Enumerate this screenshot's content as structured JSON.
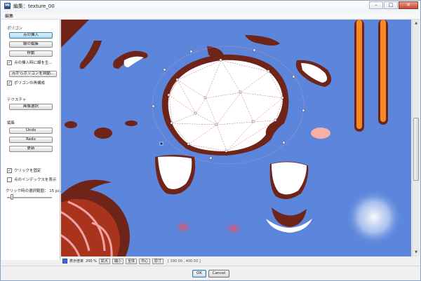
{
  "window": {
    "title": "編集：texture_00"
  },
  "menu": {
    "items": [
      "編集"
    ]
  },
  "panel": {
    "polygon_label": "ポリゴン",
    "insert_point": "点の挿入",
    "edit_line": "線の編集",
    "move": "移動",
    "insert_connect": "点の挿入時に線を生...",
    "auto_polygon": "点からポリゴンを自動...",
    "rebuild_polygon": "ポリゴンの再構成",
    "texture_label": "テクスチャ",
    "select_image": "画像選択",
    "edit_label": "編集",
    "undo": "Undo",
    "redo": "Redo",
    "refresh": "更新",
    "fix_click": "クリックを固定",
    "show_index": "点のインデックスを表示",
    "range_label": "クリック時の選択範囲：",
    "range_value": "15 pi..."
  },
  "status": {
    "zoom_label": "表示倍率",
    "zoom_value": "200 %",
    "zoom_in": "拡大",
    "zoom_out": "縮小",
    "fit_all": "全体",
    "center": "中心",
    "actual": "原寸",
    "coords": "[ 390.00 , 400.50 ]"
  },
  "dialog": {
    "ok": "OK",
    "cancel": "Cancel"
  },
  "colors": {
    "canvas_bg": "#5b86db",
    "brown": "#6e2418",
    "mesh_line": "#c0504d",
    "accent": "#3c7fb1"
  },
  "icons": {
    "app": "app-icon",
    "minimize": "minimize-icon",
    "maximize": "maximize-icon",
    "close": "close-icon"
  }
}
